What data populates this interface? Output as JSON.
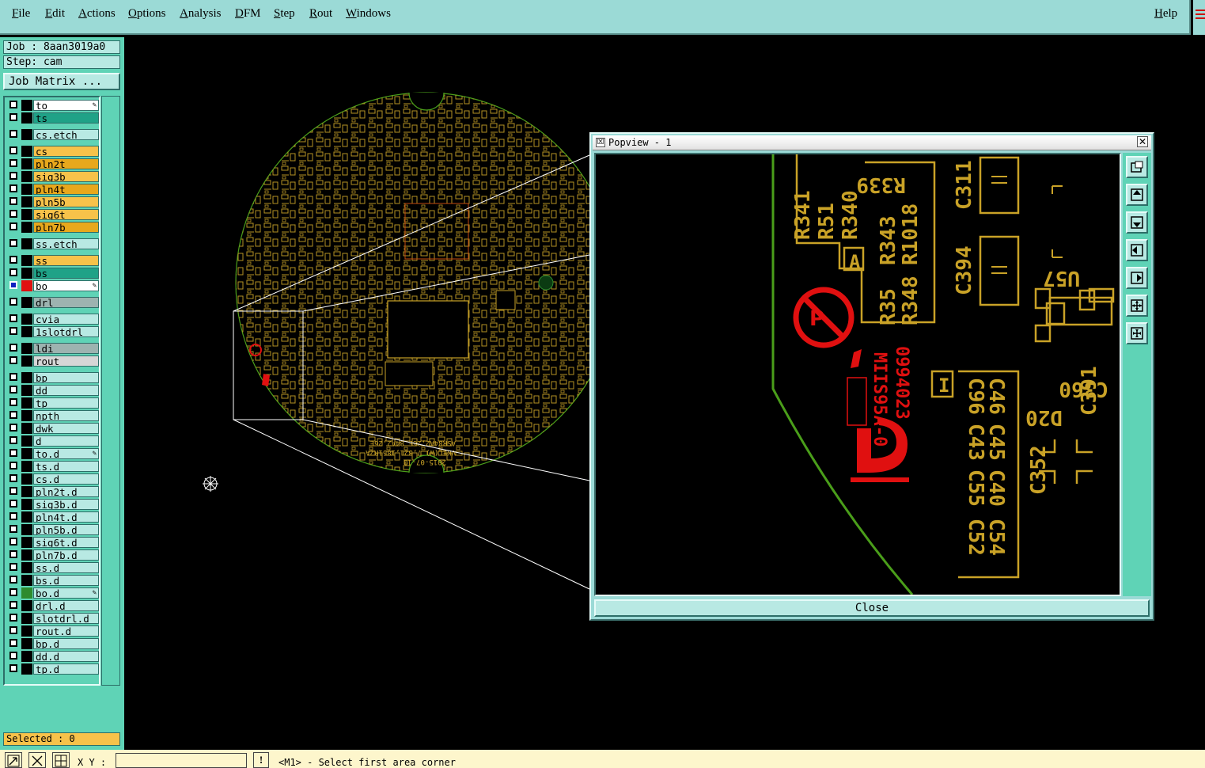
{
  "menu": {
    "file": "File",
    "edit": "Edit",
    "actions": "Actions",
    "options": "Options",
    "analysis": "Analysis",
    "dfm": "DFM",
    "step": "Step",
    "rout": "Rout",
    "windows": "Windows",
    "help": "Help"
  },
  "job": {
    "job_label": "Job : 8aan3019a0",
    "step_label": "Step: cam",
    "matrix_button": "Job Matrix ..."
  },
  "layers": [
    {
      "name": "to",
      "color": "#ffffff",
      "edit": true
    },
    {
      "name": "ts",
      "color": "#1fa287"
    },
    {
      "name": "cs.etch",
      "color": "#b8e9e3"
    },
    {
      "name": "cs",
      "color": "#f7c24a"
    },
    {
      "name": "pln2t",
      "color": "#e8a81c"
    },
    {
      "name": "sig3b",
      "color": "#f7c24a"
    },
    {
      "name": "pln4t",
      "color": "#e8a81c"
    },
    {
      "name": "pln5b",
      "color": "#f7c24a"
    },
    {
      "name": "sig6t",
      "color": "#f7c24a"
    },
    {
      "name": "pln7b",
      "color": "#e8a81c"
    },
    {
      "name": "ss.etch",
      "color": "#b8e9e3"
    },
    {
      "name": "ss",
      "color": "#f7c24a"
    },
    {
      "name": "bs",
      "color": "#1fa287"
    },
    {
      "name": "bo",
      "color": "#ffffff",
      "edit": true,
      "active": true
    },
    {
      "name": "drl",
      "color": "#9db3b0"
    },
    {
      "name": "cvia",
      "color": "#b8e9e3"
    },
    {
      "name": "1slotdrl",
      "color": "#b8e9e3"
    },
    {
      "name": "ldi",
      "color": "#9db3b0"
    },
    {
      "name": "rout",
      "color": "#d6d6d6"
    },
    {
      "name": "bp",
      "color": "#b8e9e3"
    },
    {
      "name": "dd",
      "color": "#b8e9e3"
    },
    {
      "name": "tp",
      "color": "#b8e9e3"
    },
    {
      "name": "npth",
      "color": "#b8e9e3"
    },
    {
      "name": "dwk",
      "color": "#b8e9e3"
    },
    {
      "name": "d",
      "color": "#b8e9e3"
    },
    {
      "name": "to.d",
      "color": "#b8e9e3",
      "edit": true
    },
    {
      "name": "ts.d",
      "color": "#b8e9e3"
    },
    {
      "name": "cs.d",
      "color": "#b8e9e3"
    },
    {
      "name": "pln2t.d",
      "color": "#b8e9e3"
    },
    {
      "name": "sig3b.d",
      "color": "#b8e9e3"
    },
    {
      "name": "pln4t.d",
      "color": "#b8e9e3"
    },
    {
      "name": "pln5b.d",
      "color": "#b8e9e3"
    },
    {
      "name": "sig6t.d",
      "color": "#b8e9e3"
    },
    {
      "name": "pln7b.d",
      "color": "#b8e9e3"
    },
    {
      "name": "ss.d",
      "color": "#b8e9e3"
    },
    {
      "name": "bs.d",
      "color": "#b8e9e3"
    },
    {
      "name": "bo.d",
      "color": "#b8e9e3",
      "edit": true,
      "marker": "#2e8b2e"
    },
    {
      "name": "drl.d",
      "color": "#b8e9e3"
    },
    {
      "name": "slotdrl.d",
      "color": "#b8e9e3"
    },
    {
      "name": "rout.d",
      "color": "#b8e9e3"
    },
    {
      "name": "bp.d",
      "color": "#b8e9e3"
    },
    {
      "name": "dd.d",
      "color": "#b8e9e3"
    },
    {
      "name": "tp.d",
      "color": "#b8e9e3"
    }
  ],
  "selected": "Selected : 0",
  "board_text": {
    "line1": "ASR84A2,26E.84A2,26E",
    "line2": "VKEL(W) 7,821,1851R2A",
    "line3": "2015-07-13"
  },
  "popview": {
    "title": "Popview - 1",
    "close_button": "Close",
    "labels": [
      "R341",
      "R51",
      "R340",
      "R339",
      "R343",
      "R1018",
      "R35",
      "R348",
      "C311",
      "C394",
      "U57",
      "C96",
      "C46",
      "C43",
      "C45",
      "C55",
      "C40",
      "C52",
      "C54",
      "C360",
      "C391",
      "D20",
      "C352",
      "0994023",
      "MIIS95A-0",
      "A",
      "I"
    ]
  },
  "status": {
    "xy_label": "X Y :",
    "message": "<M1> - Select first area corner",
    "info_glyph": "!"
  },
  "colors": {
    "gold": "#c9a227",
    "red": "#e01010",
    "green": "#4a9e1a",
    "panel": "#5fd3b6",
    "menubar": "#9bdad6"
  }
}
